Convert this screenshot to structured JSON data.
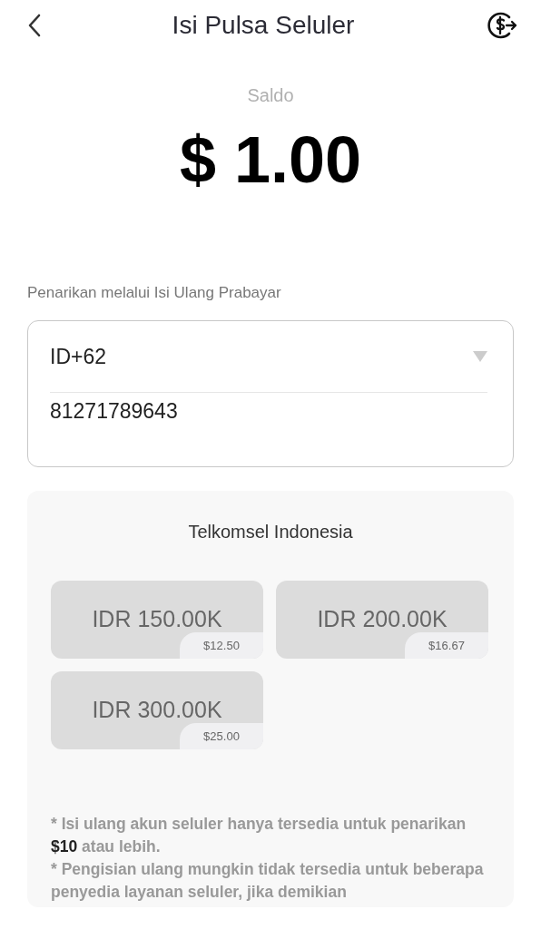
{
  "header": {
    "title": "Isi Pulsa Seluler"
  },
  "balance": {
    "label": "Saldo",
    "amount": "$ 1.00"
  },
  "form": {
    "label": "Penarikan melalui Isi Ulang Prabayar",
    "country_code": "ID+62",
    "phone": "81271789643"
  },
  "provider": {
    "name": "Telkomsel Indonesia",
    "options": [
      {
        "amount": "IDR 150.00K",
        "price": "$12.50"
      },
      {
        "amount": "IDR 200.00K",
        "price": "$16.67"
      },
      {
        "amount": "IDR 300.00K",
        "price": "$25.00"
      }
    ]
  },
  "notes": [
    "* Isi ulang akun seluler hanya tersedia untuk penarikan **$10** atau lebih.",
    "* Pengisian ulang mungkin tidak tersedia untuk beberapa penyedia layanan seluler, jika demikian"
  ]
}
